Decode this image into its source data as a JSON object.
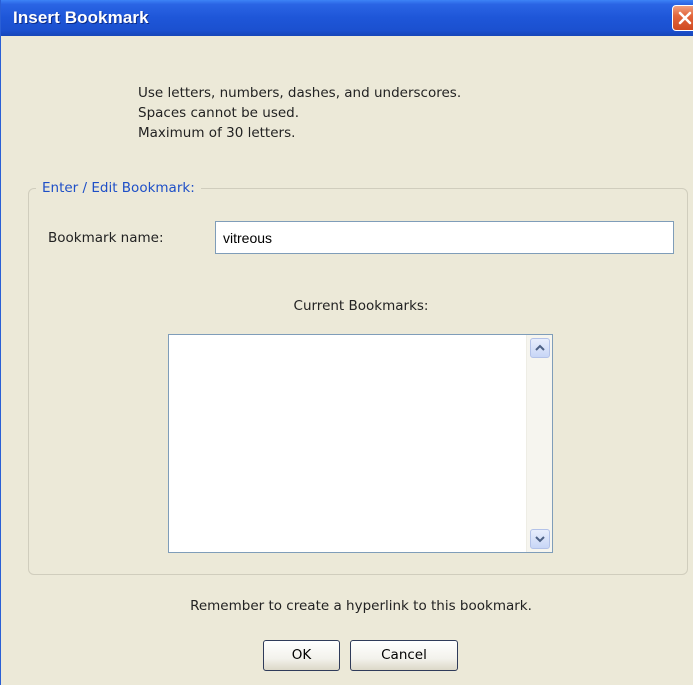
{
  "window": {
    "title": "Insert Bookmark"
  },
  "instructions": [
    "Use letters, numbers, dashes, and underscores.",
    "Spaces cannot be used.",
    "Maximum of 30 letters."
  ],
  "group": {
    "legend": "Enter / Edit Bookmark:",
    "name_label": "Bookmark name:",
    "name_value": "vitreous",
    "current_label": "Current Bookmarks:",
    "current_items": []
  },
  "footer": {
    "reminder": "Remember to create a hyperlink to this bookmark.",
    "ok_label": "OK",
    "cancel_label": "Cancel"
  },
  "icons": {
    "close": "close-icon",
    "scroll_up": "chevron-up-icon",
    "scroll_down": "chevron-down-icon"
  },
  "colors": {
    "titlebar": "#1e56d8",
    "dialog_bg": "#ece9d8",
    "legend_text": "#1e4fc7",
    "close_button": "#e2663c"
  }
}
